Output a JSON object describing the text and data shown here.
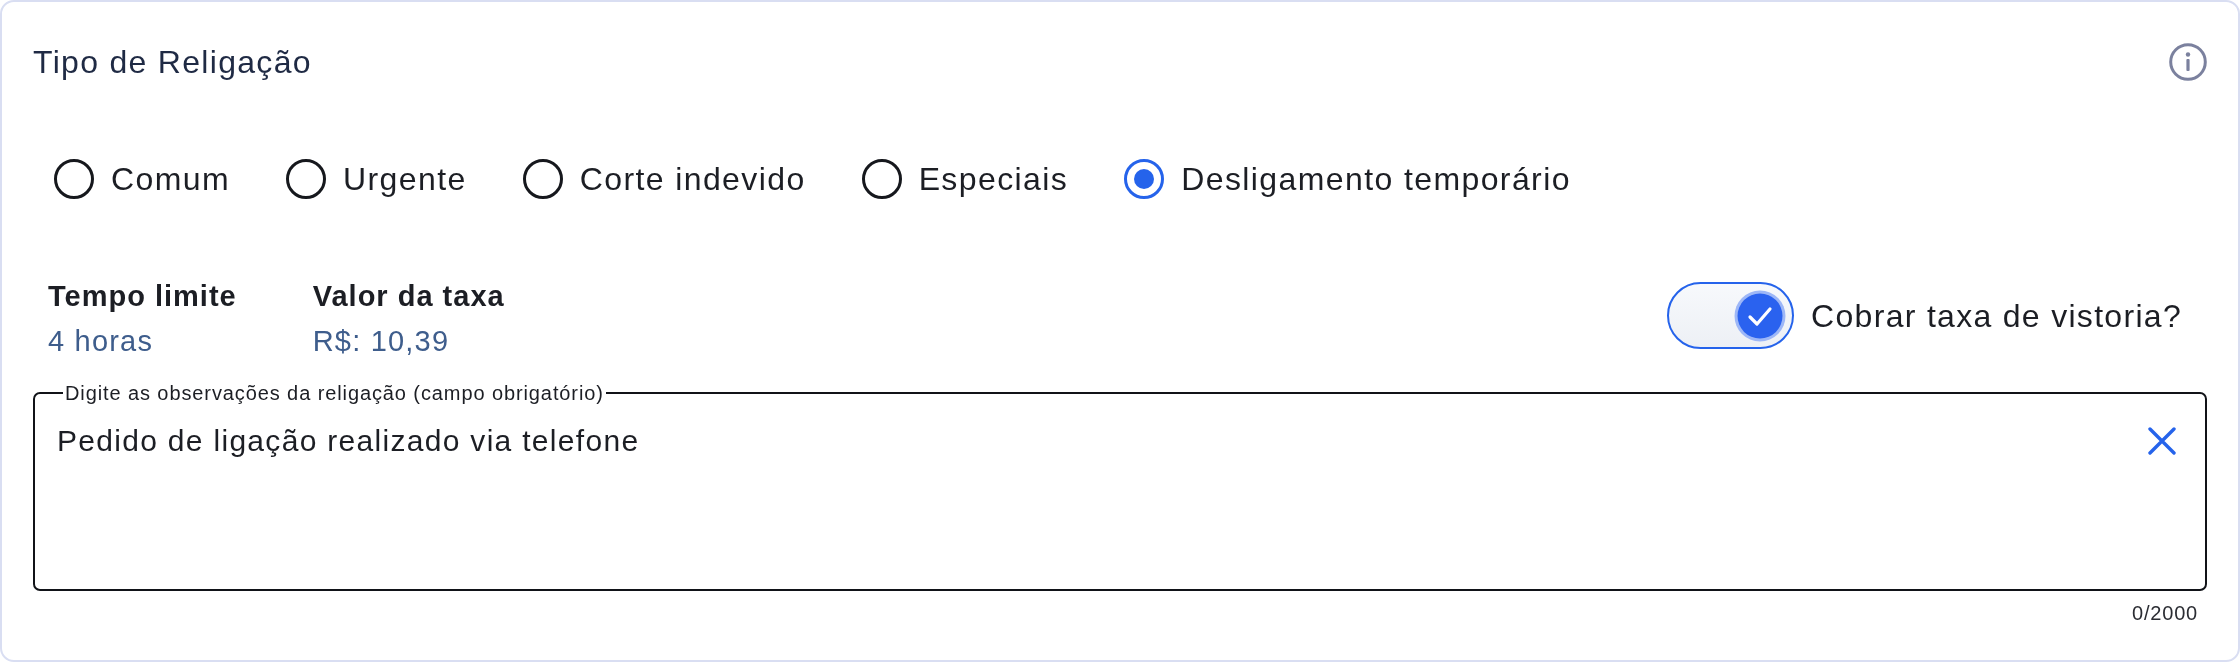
{
  "section": {
    "title": "Tipo de Religação"
  },
  "options": [
    {
      "label": "Comum",
      "selected": false
    },
    {
      "label": "Urgente",
      "selected": false
    },
    {
      "label": "Corte indevido",
      "selected": false
    },
    {
      "label": "Especiais",
      "selected": false
    },
    {
      "label": "Desligamento temporário",
      "selected": true
    }
  ],
  "details": [
    {
      "label": "Tempo limite",
      "value": "4 horas"
    },
    {
      "label": "Valor da taxa",
      "value": "R$: 10,39"
    }
  ],
  "fee_toggle": {
    "label": "Cobrar taxa de vistoria?",
    "on": true
  },
  "observations": {
    "label": "Digite as observações da religação (campo obrigatório)",
    "value": "Pedido de ligação realizado via telefone",
    "counter": "0/2000"
  }
}
